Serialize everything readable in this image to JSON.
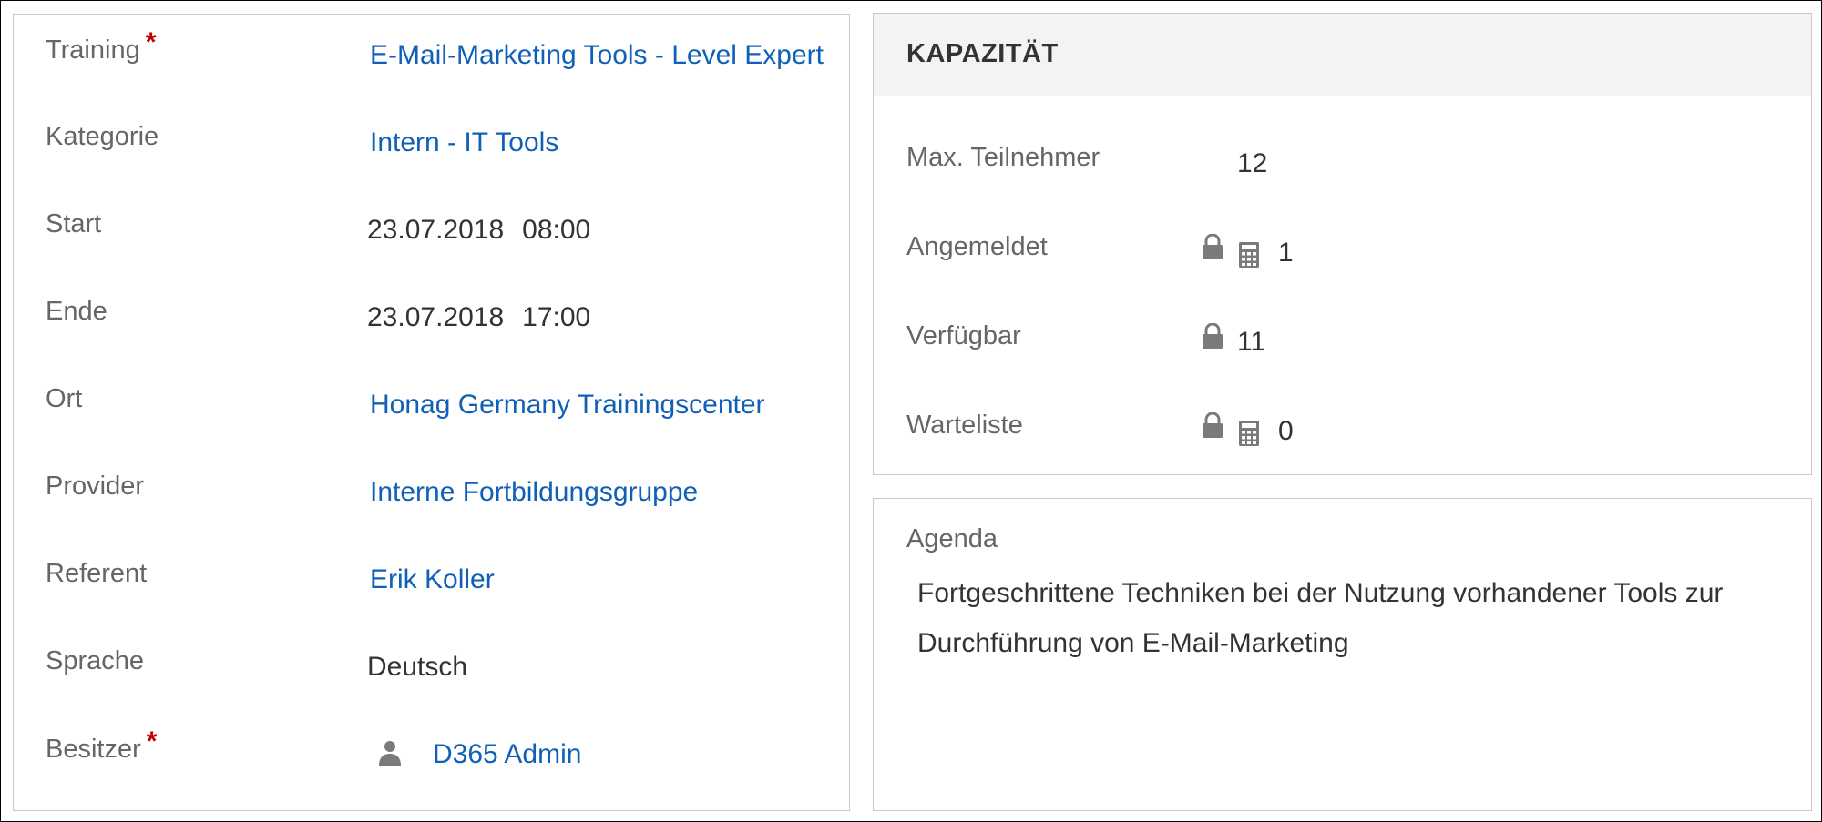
{
  "form": {
    "fields": [
      {
        "label": "Training",
        "required": true,
        "value": "E-Mail-Marketing Tools - Level Expert",
        "is_link": true
      },
      {
        "label": "Kategorie",
        "required": false,
        "value": "Intern - IT Tools",
        "is_link": true
      },
      {
        "label": "Start",
        "required": false,
        "date": "23.07.2018",
        "time": "08:00"
      },
      {
        "label": "Ende",
        "required": false,
        "date": "23.07.2018",
        "time": "17:00"
      },
      {
        "label": "Ort",
        "required": false,
        "value": "Honag Germany Trainingscenter",
        "is_link": true
      },
      {
        "label": "Provider",
        "required": false,
        "value": "Interne Fortbildungsgruppe",
        "is_link": true
      },
      {
        "label": "Referent",
        "required": false,
        "value": "Erik Koller",
        "is_link": true
      },
      {
        "label": "Sprache",
        "required": false,
        "value": "Deutsch",
        "is_link": false
      },
      {
        "label": "Besitzer",
        "required": true,
        "value": "D365 Admin",
        "is_link": true,
        "icon": "user-icon"
      }
    ],
    "required_marker": "*"
  },
  "capacity": {
    "title": "KAPAZITÄT",
    "rows": [
      {
        "label": "Max. Teilnehmer",
        "value": "12",
        "locked": false,
        "calculated": false
      },
      {
        "label": "Angemeldet",
        "value": "1",
        "locked": true,
        "calculated": true
      },
      {
        "label": "Verfügbar",
        "value": "11",
        "locked": true,
        "calculated": false
      },
      {
        "label": "Warteliste",
        "value": "0",
        "locked": true,
        "calculated": true
      }
    ]
  },
  "agenda": {
    "label": "Agenda",
    "text": "Fortgeschrittene Techniken bei der Nutzung vorhandener Tools zur Durchführung von E-Mail-Marketing"
  },
  "colors": {
    "link": "#1160b7",
    "label": "#666666",
    "value": "#333333",
    "required": "#c00000",
    "panel_border": "#c8c8c8",
    "header_bg": "#f3f3f3",
    "icon": "#7a7a7a"
  }
}
